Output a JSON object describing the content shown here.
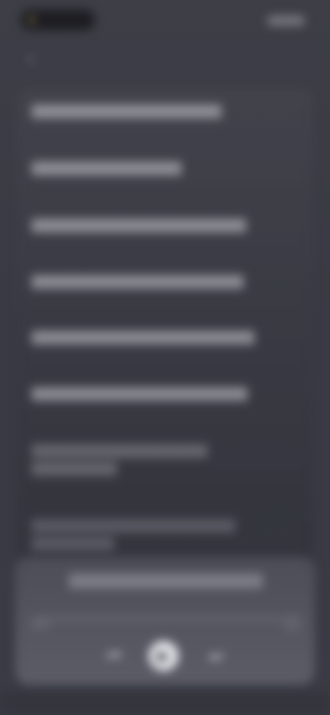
{
  "status_bar": {
    "time": "",
    "icons": [
      "status-pill",
      "battery-icon"
    ]
  },
  "header": {
    "title": "",
    "back_icon": "chevron-left-icon"
  },
  "lyrics": {
    "lines": [
      {
        "text": "",
        "dim": false
      },
      {
        "text": "",
        "dim": false
      },
      {
        "text": "",
        "dim": false
      },
      {
        "text": "",
        "dim": false
      },
      {
        "text": "",
        "dim": false
      },
      {
        "text": "",
        "dim": false
      },
      {
        "text": "",
        "dim": true
      },
      {
        "text": "",
        "dim": true
      },
      {
        "text": "",
        "dim": true
      },
      {
        "text": "",
        "dim": true
      }
    ]
  },
  "player": {
    "track_title": "",
    "progress_fraction": 0.0,
    "controls": {
      "prev_icon": "skip-previous-icon",
      "play_icon": "play-icon",
      "next_icon": "skip-next-icon"
    }
  },
  "colors": {
    "background": "#3b3c44",
    "player_background": "#52535d",
    "text_primary": "#e4e5ea"
  }
}
